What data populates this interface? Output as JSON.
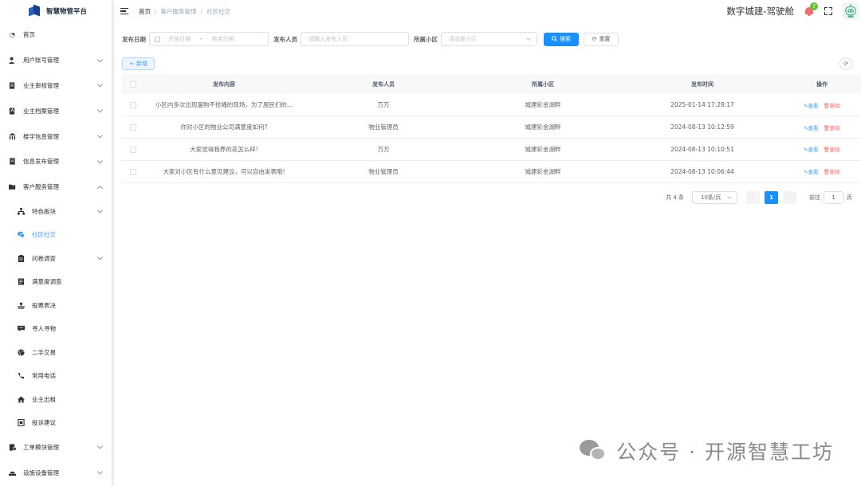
{
  "app": {
    "name": "智慧物管平台",
    "system_title": "数字城建-驾驶舱",
    "notification_count": "7"
  },
  "breadcrumb": [
    "首页",
    "客户服务管理",
    "社区社交"
  ],
  "sidebar": {
    "items": [
      {
        "label": "首页",
        "icon": "dashboard-icon"
      },
      {
        "label": "用户账号管理",
        "icon": "user-icon"
      },
      {
        "label": "业主审核管理",
        "icon": "audit-icon"
      },
      {
        "label": "业主档案管理",
        "icon": "archive-icon"
      },
      {
        "label": "楼宇信息管理",
        "icon": "building-icon"
      },
      {
        "label": "信息发布管理",
        "icon": "publish-icon"
      },
      {
        "label": "客户服务管理",
        "icon": "folder-open-icon"
      }
    ],
    "sub_items": [
      {
        "label": "特色板块",
        "icon": "tree-icon"
      },
      {
        "label": "社区社交",
        "icon": "chat-icon"
      },
      {
        "label": "问卷调查",
        "icon": "clipboard-icon"
      },
      {
        "label": "满意度调查",
        "icon": "survey-icon"
      },
      {
        "label": "投票表决",
        "icon": "vote-icon"
      },
      {
        "label": "寻人寻物",
        "icon": "message-icon"
      },
      {
        "label": "二手交易",
        "icon": "globe-icon"
      },
      {
        "label": "常用电话",
        "icon": "phone-icon"
      },
      {
        "label": "业主出租",
        "icon": "home-icon"
      },
      {
        "label": "投诉建议",
        "icon": "complaint-icon"
      }
    ],
    "bottom_items": [
      {
        "label": "工单模块管理",
        "icon": "ticket-icon"
      },
      {
        "label": "设施设备管理",
        "icon": "device-icon"
      }
    ]
  },
  "filters": {
    "date_label": "发布日期",
    "start_placeholder": "开始日期",
    "range_separator": "-",
    "end_placeholder": "结束日期",
    "publisher_label": "发布人员",
    "publisher_placeholder": "请输入发布人员",
    "community_label": "所属小区",
    "community_placeholder": "请选择小区",
    "search_label": "搜索",
    "reset_label": "重置"
  },
  "toolbar": {
    "add_label": "新增"
  },
  "table": {
    "headers": [
      "发布内容",
      "发布人员",
      "所属小区",
      "发布时间",
      "操作"
    ],
    "rows": [
      {
        "content": "小区内多次出现遛狗不拴绳的现场，为了居民们的...",
        "publisher": "万万",
        "community": "城建彩金湖畔",
        "time": "2025-01-14 17:28:17"
      },
      {
        "content": "你对小区的物业公司满意度如何?",
        "publisher": "物业管理员",
        "community": "城建彩金湖畔",
        "time": "2024-08-13 10:12:59"
      },
      {
        "content": "大家觉得我养的花怎么样!",
        "publisher": "万万",
        "community": "城建彩金湖畔",
        "time": "2024-08-13 10:10:51"
      },
      {
        "content": "大家对小区有什么意见建议，可以自由发表哦!",
        "publisher": "物业管理员",
        "community": "城建彩金湖畔",
        "time": "2024-08-13 10:06:44"
      }
    ],
    "op_view": "查看",
    "op_delete": "删除"
  },
  "pagination": {
    "total": "共 4 条",
    "page_size": "10条/页",
    "current_page": "1",
    "goto_label": "前往",
    "goto_value": "1",
    "page_unit": "页"
  },
  "watermark": {
    "text": "公众号 · 开源智慧工坊"
  },
  "colors": {
    "primary": "#1890ff",
    "danger": "#f56c6c",
    "success_badge": "#67c23a"
  }
}
